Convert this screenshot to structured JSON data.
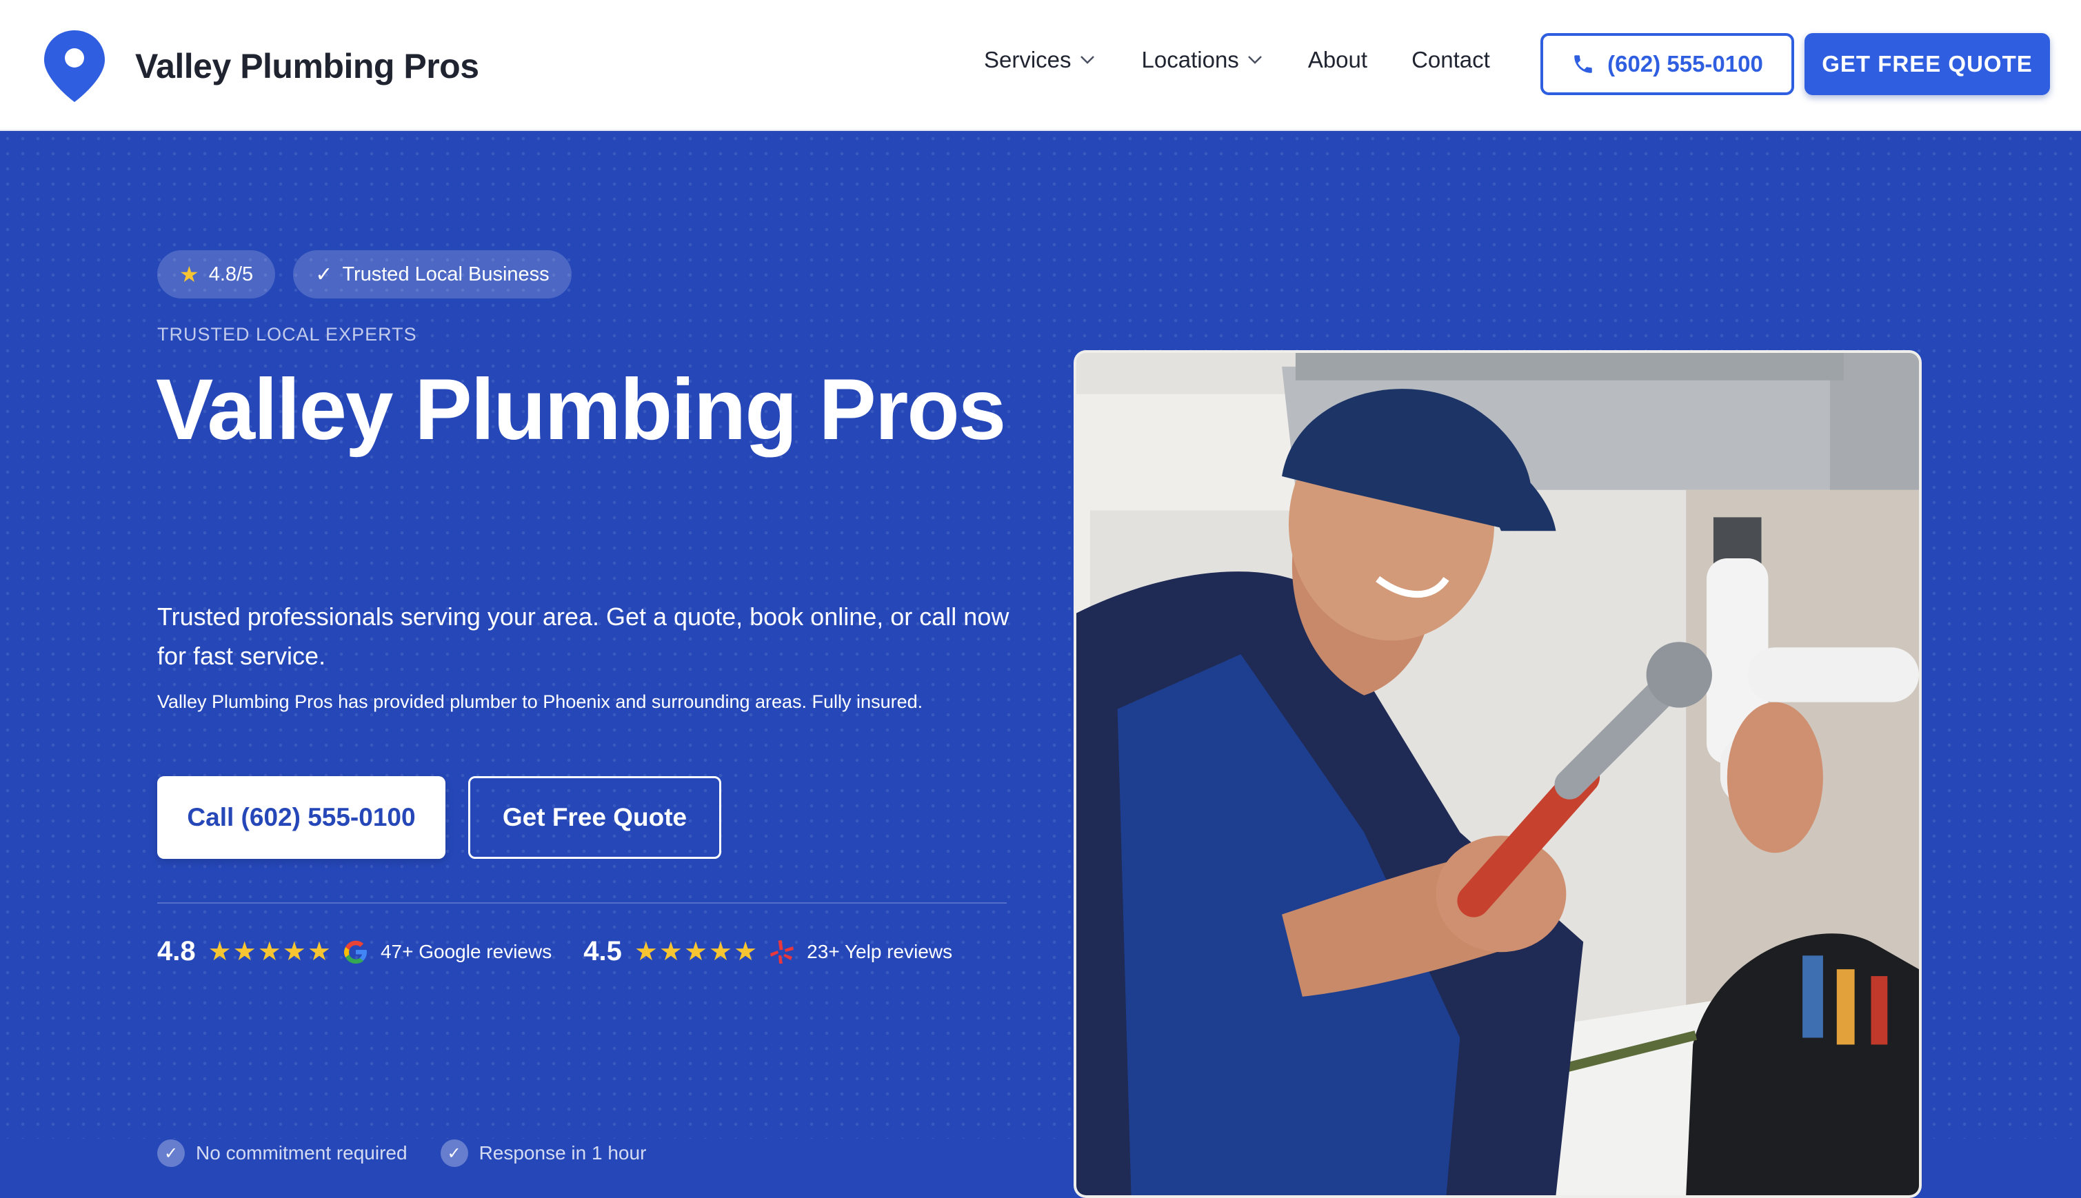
{
  "header": {
    "brand_name": "Valley Plumbing Pros",
    "nav": {
      "services": "Services",
      "locations": "Locations",
      "about": "About",
      "contact": "Contact"
    },
    "phone_label": "(602) 555-0100",
    "quote_label": "GET FREE QUOTE"
  },
  "hero": {
    "badges": {
      "rating": "4.8/5",
      "trusted": "Trusted Local Business"
    },
    "eyebrow": "TRUSTED LOCAL EXPERTS",
    "title": "Valley Plumbing Pros",
    "subtitle": "Trusted professionals serving your area. Get a quote, book online, or call now for fast service.",
    "description": "Valley Plumbing Pros has provided plumber to Phoenix and surrounding areas. Fully insured.",
    "cta_call": "Call (602) 555-0100",
    "cta_quote": "Get Free Quote",
    "reviews": {
      "google_score": "4.8",
      "google_text": "47+ Google reviews",
      "yelp_score": "4.5",
      "yelp_text": "23+ Yelp reviews",
      "stars": "★★★★★"
    },
    "perks": {
      "no_commitment": "No commitment required",
      "response": "Response in 1 hour"
    }
  },
  "colors": {
    "brand_blue": "#2f5fe0",
    "hero_bg": "#2547b8",
    "star_yellow": "#f7c531"
  },
  "icons": [
    "location-pin-icon",
    "chevron-down-icon",
    "phone-icon",
    "star-icon",
    "check-icon",
    "google-icon",
    "yelp-icon"
  ]
}
